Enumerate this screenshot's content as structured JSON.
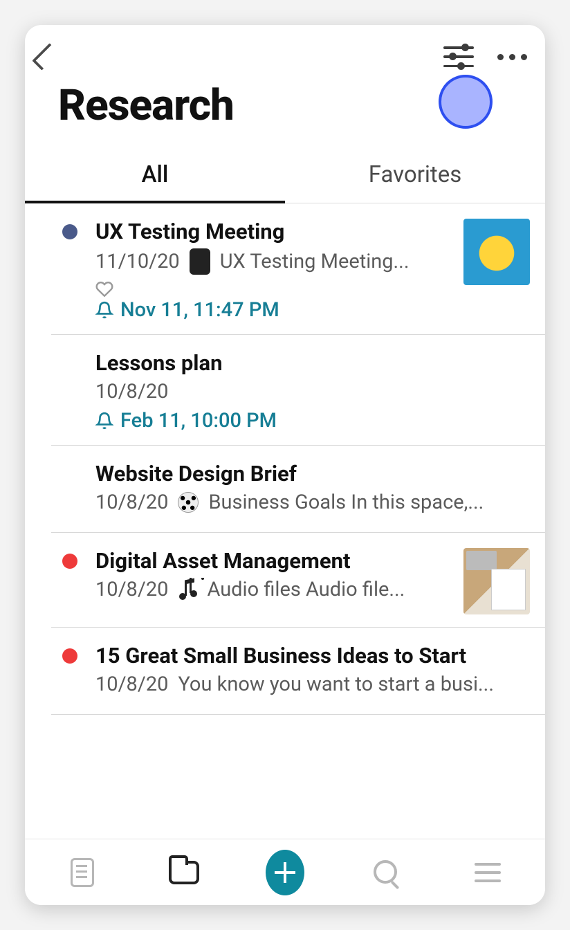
{
  "header": {
    "title": "Research"
  },
  "tabs": [
    {
      "label": "All",
      "active": true
    },
    {
      "label": "Favorites",
      "active": false
    }
  ],
  "colors": {
    "accent": "#167e95",
    "navy_dot": "#4a5a8a",
    "red_dot": "#ee3a3a",
    "touch_fill": "#a9b4ff",
    "touch_border": "#2e4ff0"
  },
  "notes": [
    {
      "dot": "navy",
      "title": "UX Testing Meeting",
      "date": "11/10/20",
      "inline_icon": "watch-icon",
      "excerpt": "UX Testing Meeting...",
      "has_favorite_toggle": true,
      "reminder": "Nov 11, 11:47 PM",
      "thumb": "lightbulb"
    },
    {
      "dot": null,
      "title": "Lessons plan",
      "date": "10/8/20",
      "inline_icon": null,
      "excerpt": "",
      "has_favorite_toggle": false,
      "reminder": "Feb 11, 10:00 PM",
      "thumb": null
    },
    {
      "dot": null,
      "title": "Website Design Brief",
      "date": "10/8/20",
      "inline_icon": "soccer-icon",
      "excerpt": "Business Goals  In this space,...",
      "has_favorite_toggle": false,
      "reminder": null,
      "thumb": null
    },
    {
      "dot": "red",
      "title": "Digital Asset Management",
      "date": "10/8/20",
      "inline_icon": "music-icon",
      "excerpt": "Audio files  Audio file...",
      "has_favorite_toggle": false,
      "reminder": null,
      "thumb": "desk"
    },
    {
      "dot": "red",
      "title": "15 Great Small Business Ideas to Start",
      "date": "10/8/20",
      "inline_icon": null,
      "excerpt": "You know you want to start a busi...",
      "has_favorite_toggle": false,
      "reminder": null,
      "thumb": null
    }
  ],
  "bottomnav": {
    "items": [
      "notes",
      "folders",
      "add",
      "search",
      "menu"
    ],
    "active": "folders"
  }
}
